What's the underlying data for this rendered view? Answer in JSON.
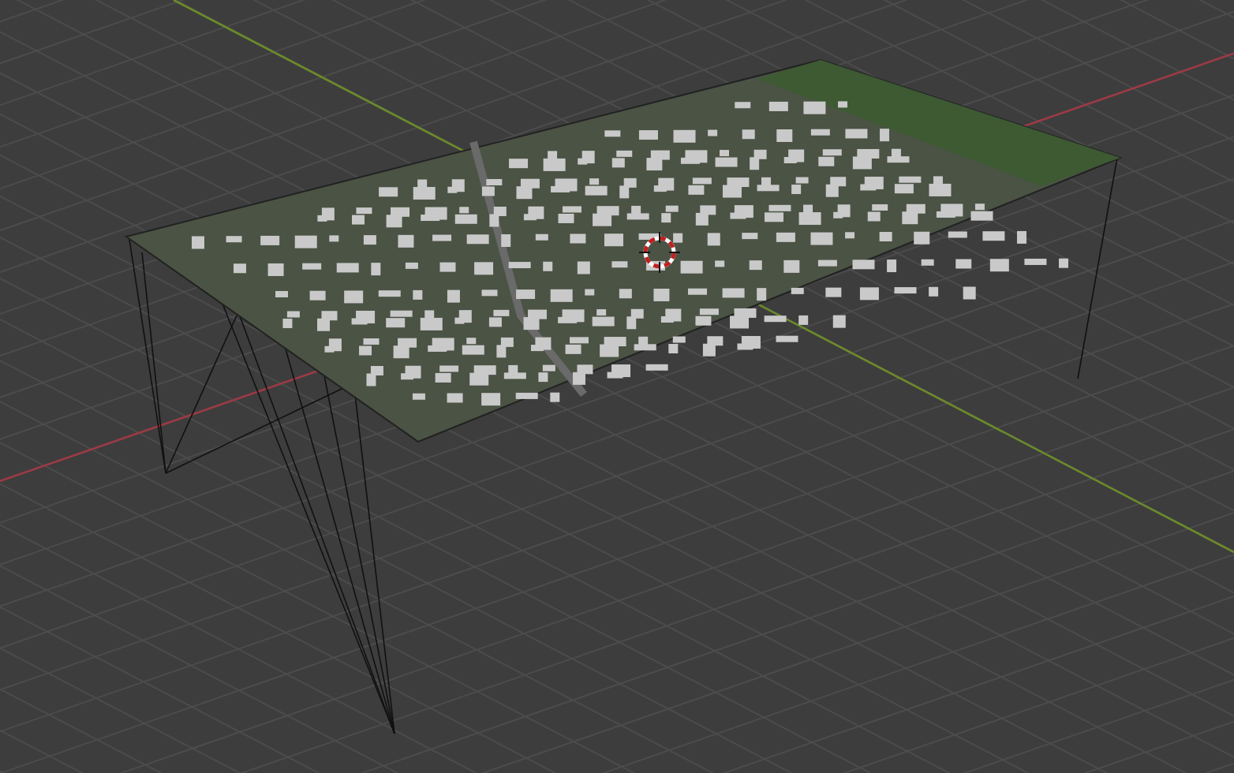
{
  "viewport": {
    "objects": [
      {
        "kind": "grid"
      },
      {
        "kind": "axis-x"
      },
      {
        "kind": "axis-y"
      },
      {
        "kind": "terrain"
      },
      {
        "kind": "cursor"
      }
    ]
  }
}
